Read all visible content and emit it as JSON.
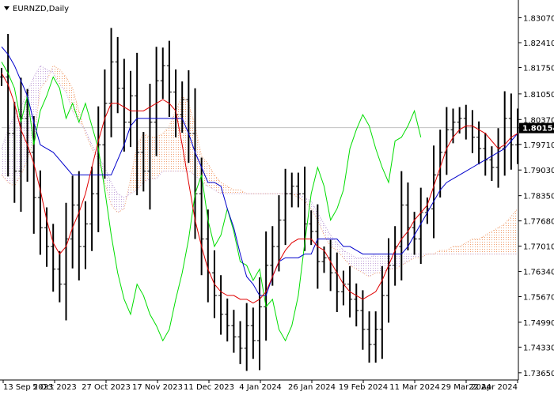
{
  "window": {
    "title": "EURNZD,Daily",
    "collapse_icon": "triangle-down-icon"
  },
  "price_label": "1.80154",
  "colors": {
    "background": "#ffffff",
    "axis": "#000000",
    "bars": "#000000",
    "tenkan": "#e00000",
    "kijun": "#0000cc",
    "chikou": "#00dd00",
    "cloud_up": "#f0a070",
    "cloud_down": "#c0a0d8",
    "current_price_line": "#c0c0c0",
    "price_label_bg": "#000000"
  },
  "chart_data": {
    "type": "line",
    "symbol": "EURNZD",
    "timeframe": "Daily",
    "ylim": [
      1.735,
      1.835
    ],
    "yticks": [
      1.8307,
      1.8241,
      1.8175,
      1.8105,
      1.8037,
      1.7971,
      1.7903,
      1.7835,
      1.7768,
      1.7701,
      1.7634,
      1.7567,
      1.7499,
      1.7433,
      1.7365
    ],
    "ytick_labels": [
      "1.83070",
      "1.82410",
      "1.81750",
      "1.81050",
      "1.80370",
      "1.79710",
      "1.79030",
      "1.78350",
      "1.77680",
      "1.77010",
      "1.76340",
      "1.75670",
      "1.74990",
      "1.74330",
      "1.73650"
    ],
    "x_dates": [
      "13 Sep 2023",
      "5 Oct 2023",
      "27 Oct 2023",
      "17 Nov 2023",
      "11 Dec 2023",
      "4 Jan 2024",
      "26 Jan 2024",
      "19 Feb 2024",
      "11 Mar 2024",
      "29 Mar 2024",
      "22 Apr 2024"
    ],
    "current_price": 1.80154,
    "series": [
      {
        "key": "close",
        "values": [
          1.815,
          1.8,
          1.79,
          1.804,
          1.795,
          1.783,
          1.775,
          1.77,
          1.764,
          1.76,
          1.772,
          1.781,
          1.77,
          1.776,
          1.784,
          1.797,
          1.808,
          1.819,
          1.812,
          1.803,
          1.81,
          1.795,
          1.79,
          1.803,
          1.814,
          1.818,
          1.811,
          1.805,
          1.809,
          1.8,
          1.784,
          1.772,
          1.763,
          1.757,
          1.752,
          1.749,
          1.746,
          1.743,
          1.749,
          1.745,
          1.754,
          1.765,
          1.77,
          1.777,
          1.784,
          1.786,
          1.784,
          1.776,
          1.774,
          1.766,
          1.767,
          1.763,
          1.758,
          1.76,
          1.756,
          1.753,
          1.748,
          1.744,
          1.748,
          1.757,
          1.765,
          1.77,
          1.781,
          1.775,
          1.772,
          1.779,
          1.78,
          1.789,
          1.795,
          1.801,
          1.803,
          1.804,
          1.802,
          1.799,
          1.796,
          1.793,
          1.791,
          1.796,
          1.804,
          1.797,
          1.8015
        ]
      },
      {
        "key": "tenkan",
        "name": "",
        "values": [
          1.816,
          1.813,
          1.808,
          1.801,
          1.797,
          1.792,
          1.785,
          1.777,
          1.771,
          1.768,
          1.77,
          1.775,
          1.779,
          1.784,
          1.791,
          1.798,
          1.804,
          1.808,
          1.808,
          1.807,
          1.806,
          1.806,
          1.806,
          1.807,
          1.808,
          1.809,
          1.808,
          1.806,
          1.797,
          1.787,
          1.777,
          1.77,
          1.764,
          1.76,
          1.758,
          1.757,
          1.757,
          1.756,
          1.756,
          1.755,
          1.756,
          1.758,
          1.762,
          1.766,
          1.769,
          1.771,
          1.772,
          1.772,
          1.772,
          1.77,
          1.769,
          1.766,
          1.763,
          1.76,
          1.758,
          1.757,
          1.756,
          1.757,
          1.758,
          1.761,
          1.765,
          1.769,
          1.772,
          1.774,
          1.777,
          1.779,
          1.781,
          1.786,
          1.791,
          1.796,
          1.799,
          1.801,
          1.802,
          1.802,
          1.801,
          1.8,
          1.798,
          1.796,
          1.797,
          1.799,
          1.8
        ]
      },
      {
        "key": "kijun",
        "name": "",
        "values": [
          1.823,
          1.821,
          1.818,
          1.814,
          1.81,
          1.803,
          1.797,
          1.796,
          1.795,
          1.793,
          1.791,
          1.789,
          1.789,
          1.789,
          1.789,
          1.789,
          1.789,
          1.789,
          1.793,
          1.797,
          1.802,
          1.804,
          1.804,
          1.804,
          1.804,
          1.804,
          1.804,
          1.804,
          1.804,
          1.8,
          1.795,
          1.791,
          1.787,
          1.787,
          1.786,
          1.78,
          1.775,
          1.768,
          1.762,
          1.76,
          1.757,
          1.757,
          1.762,
          1.766,
          1.767,
          1.767,
          1.767,
          1.768,
          1.768,
          1.772,
          1.772,
          1.772,
          1.772,
          1.77,
          1.77,
          1.769,
          1.768,
          1.768,
          1.768,
          1.768,
          1.768,
          1.768,
          1.768,
          1.77,
          1.773,
          1.776,
          1.779,
          1.782,
          1.785,
          1.787,
          1.788,
          1.789,
          1.79,
          1.791,
          1.792,
          1.793,
          1.794,
          1.795,
          1.796,
          1.798,
          1.8
        ]
      },
      {
        "key": "chikou",
        "name": "",
        "values": [
          1.819,
          1.816,
          1.812,
          1.803,
          1.81,
          1.797,
          1.806,
          1.81,
          1.815,
          1.812,
          1.804,
          1.808,
          1.803,
          1.808,
          1.802,
          1.796,
          1.785,
          1.773,
          1.763,
          1.756,
          1.752,
          1.76,
          1.757,
          1.752,
          1.749,
          1.745,
          1.748,
          1.756,
          1.763,
          1.772,
          1.784,
          1.789,
          1.777,
          1.77,
          1.773,
          1.78,
          1.774,
          1.766,
          1.765,
          1.761,
          1.764,
          1.754,
          1.756,
          1.748,
          1.745,
          1.749,
          1.757,
          1.771,
          1.784,
          1.791,
          1.786,
          1.777,
          1.78,
          1.785,
          1.796,
          1.801,
          1.805,
          1.802,
          1.796,
          1.791,
          1.787,
          1.798,
          1.799,
          1.802,
          1.806,
          1.799
        ]
      },
      {
        "key": "span_a",
        "name": "",
        "values": [
          1.789,
          1.787,
          1.786,
          1.789,
          1.793,
          1.798,
          1.812,
          1.814,
          1.818,
          1.817,
          1.815,
          1.812,
          1.806,
          1.8,
          1.796,
          1.793,
          1.787,
          1.781,
          1.779,
          1.78,
          1.788,
          1.797,
          1.8,
          1.799,
          1.799,
          1.8,
          1.802,
          1.806,
          1.81,
          1.808,
          1.802,
          1.794,
          1.792,
          1.789,
          1.787,
          1.786,
          1.785,
          1.785,
          1.784,
          1.784,
          1.784,
          1.784,
          1.784,
          1.784,
          1.784,
          1.784,
          1.783,
          1.782,
          1.78,
          1.777,
          1.773,
          1.77,
          1.769,
          1.767,
          1.765,
          1.764,
          1.763,
          1.762,
          1.763,
          1.763,
          1.764,
          1.764,
          1.765,
          1.766,
          1.767,
          1.767,
          1.768,
          1.768,
          1.769,
          1.769,
          1.77,
          1.77,
          1.771,
          1.772,
          1.772,
          1.773,
          1.774,
          1.775,
          1.776,
          1.778,
          1.78
        ]
      },
      {
        "key": "span_b",
        "name": "",
        "values": [
          1.796,
          1.801,
          1.805,
          1.807,
          1.811,
          1.815,
          1.818,
          1.817,
          1.816,
          1.813,
          1.811,
          1.806,
          1.803,
          1.801,
          1.797,
          1.794,
          1.791,
          1.787,
          1.784,
          1.783,
          1.784,
          1.785,
          1.787,
          1.788,
          1.788,
          1.79,
          1.79,
          1.79,
          1.79,
          1.79,
          1.789,
          1.787,
          1.786,
          1.785,
          1.784,
          1.784,
          1.784,
          1.784,
          1.784,
          1.784,
          1.784,
          1.784,
          1.784,
          1.784,
          1.784,
          1.784,
          1.784,
          1.783,
          1.782,
          1.779,
          1.776,
          1.773,
          1.771,
          1.769,
          1.768,
          1.767,
          1.767,
          1.767,
          1.768,
          1.768,
          1.768,
          1.768,
          1.768,
          1.768,
          1.768,
          1.768,
          1.768,
          1.768,
          1.768,
          1.768,
          1.768,
          1.768,
          1.768,
          1.768,
          1.768,
          1.768,
          1.768,
          1.768,
          1.768,
          1.768,
          1.768
        ]
      }
    ]
  }
}
